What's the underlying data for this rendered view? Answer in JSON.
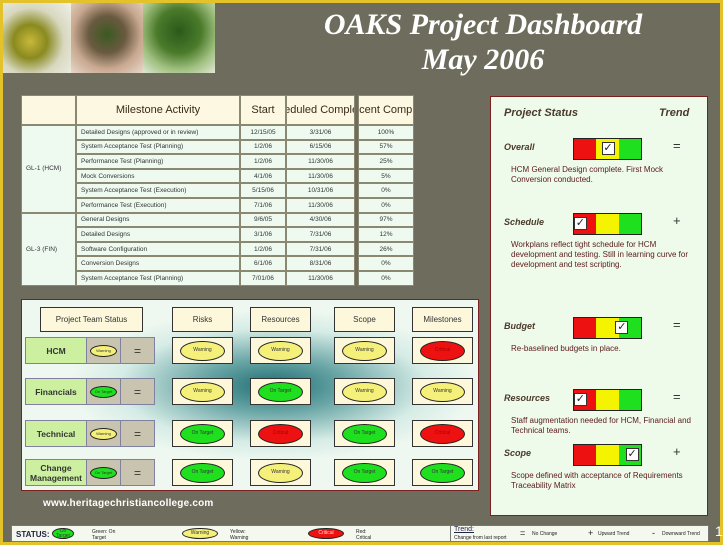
{
  "header": {
    "title_line1": "OAKS Project Dashboard",
    "title_line2": "May 2006"
  },
  "milestones": {
    "headers": [
      "Milestone Activity",
      "Start",
      "Scheduled Completion",
      "Percent Complete"
    ],
    "groups": [
      {
        "name": "GL-1 (HCM)",
        "rows": [
          [
            "Detailed Designs (approved or in review)",
            "12/15/05",
            "3/31/06",
            "100%"
          ],
          [
            "System Acceptance Test (Planning)",
            "1/2/06",
            "6/15/06",
            "57%"
          ],
          [
            "Performance Test (Planning)",
            "1/2/06",
            "11/30/06",
            "25%"
          ],
          [
            "Mock Conversions",
            "4/1/06",
            "11/30/06",
            "5%"
          ],
          [
            "System Acceptance Test (Execution)",
            "5/15/06",
            "10/31/06",
            "0%"
          ],
          [
            "Performance Test (Execution)",
            "7/1/06",
            "11/30/06",
            "0%"
          ]
        ]
      },
      {
        "name": "GL-3 (FIN)",
        "rows": [
          [
            "General Designs",
            "9/6/05",
            "4/30/06",
            "97%"
          ],
          [
            "Detailed Designs",
            "3/1/06",
            "7/31/06",
            "12%"
          ],
          [
            "Software Configuration",
            "1/2/06",
            "7/31/06",
            "26%"
          ],
          [
            "Conversion Designs",
            "6/1/06",
            "8/31/06",
            "0%"
          ],
          [
            "System Acceptance Test (Planning)",
            "7/01/06",
            "11/30/06",
            "0%"
          ]
        ]
      }
    ]
  },
  "team_status": {
    "header": "Project Team Status",
    "columns": [
      "Risks",
      "Resources",
      "Scope",
      "Milestones"
    ],
    "labels": {
      "green": "On Target",
      "yellow": "Warning",
      "red": "Critical"
    },
    "rows": [
      {
        "team": "HCM",
        "status": "yellow",
        "trend": "=",
        "cells": [
          "yellow",
          "yellow",
          "yellow",
          "red"
        ]
      },
      {
        "team": "Financials",
        "status": "green",
        "trend": "=",
        "cells": [
          "yellow",
          "green",
          "yellow",
          "yellow"
        ]
      },
      {
        "team": "Technical",
        "status": "yellow",
        "trend": "=",
        "cells": [
          "green",
          "red",
          "green",
          "red"
        ]
      },
      {
        "team": "Change Management",
        "status": "green",
        "trend": "=",
        "cells": [
          "green",
          "yellow",
          "green",
          "green"
        ]
      }
    ]
  },
  "watermark": "www.heritagechristiancollege.com",
  "project_status": {
    "title": "Project Status",
    "trend_title": "Trend",
    "items": [
      {
        "label": "Overall",
        "level": "yellow",
        "level_pos": 0.5,
        "trend": "=",
        "text": "HCM General Design complete.  First Mock Conversion conducted."
      },
      {
        "label": "Schedule",
        "level": "red",
        "level_pos": 0.1,
        "trend": "+",
        "text": "Workplans reflect tight schedule for HCM development and testing.  Still in learning curve for development and test scripting."
      },
      {
        "label": "Budget",
        "level": "yellow-green",
        "level_pos": 0.7,
        "trend": "=",
        "text": "Re-baselined budgets in place."
      },
      {
        "label": "Resources",
        "level": "red",
        "level_pos": 0.1,
        "trend": "=",
        "text": "Staff augmentation needed for HCM, Financial and Technical teams."
      },
      {
        "label": "Scope",
        "level": "green",
        "level_pos": 0.85,
        "trend": "+",
        "text": "Scope defined with acceptance of Requirements Traceability Matrix"
      }
    ]
  },
  "legend": {
    "status_label": "STATUS:",
    "green_oval": "On Target",
    "green_desc": "Green: On Target",
    "yellow_oval": "Warning",
    "yellow_desc": "Yellow: Warning",
    "red_oval": "Critical",
    "red_desc": "Red: Critical",
    "trend_label": "Trend:",
    "trend_sub": "Change from last report",
    "no_change_sym": "=",
    "no_change": "No Change",
    "up_sym": "+",
    "up": "Upward Trend",
    "down_sym": "-",
    "down": "Downward Trend"
  },
  "page_number": "1",
  "colors": {
    "red": "#ee1111",
    "yellow": "#f5f07a",
    "green": "#1fe01f",
    "background": "#6e6c5c",
    "frame": "#e3c22a"
  }
}
